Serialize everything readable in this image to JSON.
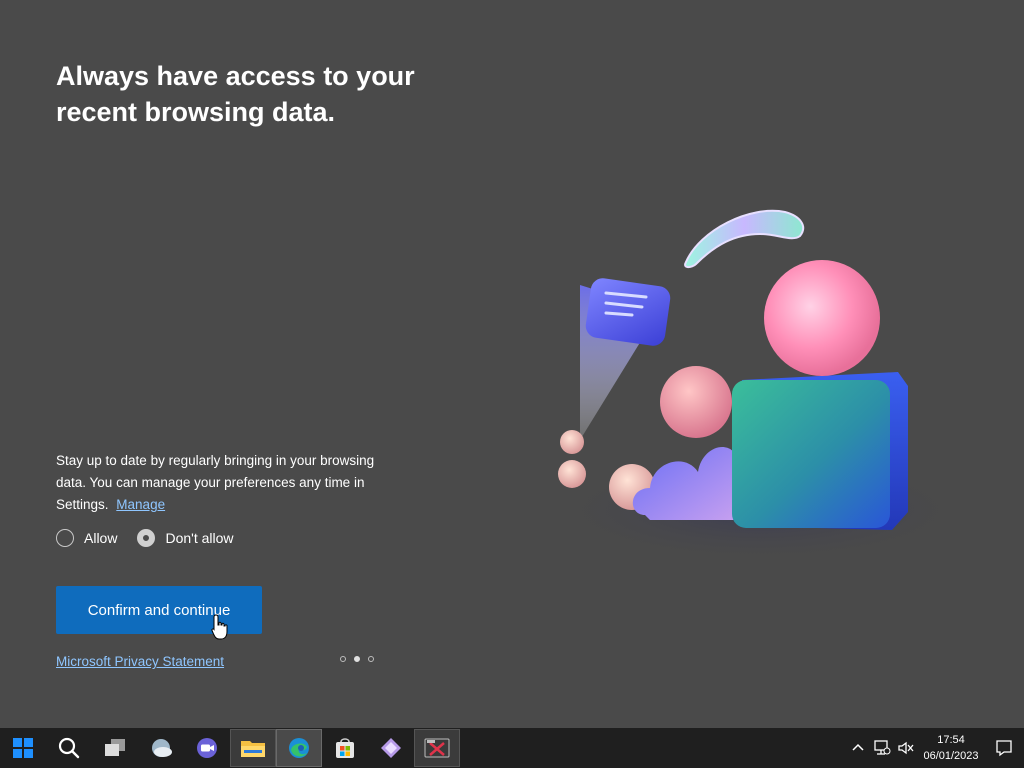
{
  "page": {
    "headline": "Always have access to your recent browsing data.",
    "description": "Stay up to date by regularly bringing in your browsing data. You can manage your preferences any time in Settings.",
    "manage_link": "Manage",
    "radio_options": [
      {
        "label": "Allow",
        "selected": false
      },
      {
        "label": "Don't allow",
        "selected": true
      }
    ],
    "confirm_button": "Confirm and continue",
    "privacy_link": "Microsoft Privacy Statement",
    "pager": {
      "total": 3,
      "current": 2
    }
  },
  "taskbar": {
    "items": [
      {
        "name": "windows-start-icon"
      },
      {
        "name": "search-icon"
      },
      {
        "name": "task-view-icon"
      },
      {
        "name": "widgets-icon"
      },
      {
        "name": "chat-icon"
      },
      {
        "name": "file-explorer-icon"
      },
      {
        "name": "edge-browser-icon"
      },
      {
        "name": "microsoft-store-icon"
      },
      {
        "name": "app-icon"
      },
      {
        "name": "snipping-tool-icon"
      }
    ],
    "clock": {
      "time": "17:54",
      "date": "06/01/2023"
    }
  },
  "colors": {
    "background": "#4a4a4a",
    "accent": "#0f6cbd",
    "link": "#8fc6ff",
    "taskbar": "#1f1f1f"
  }
}
